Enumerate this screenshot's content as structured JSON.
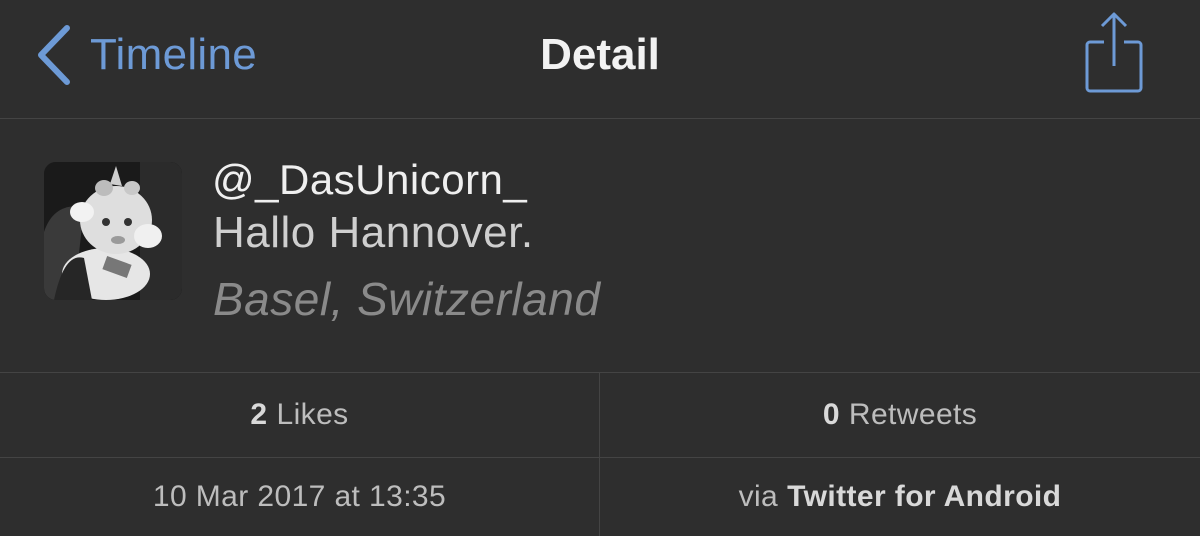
{
  "navbar": {
    "back_label": "Timeline",
    "title": "Detail",
    "accent_color": "#6d9ad6",
    "back_icon": "chevron-left-icon",
    "share_icon": "share-icon"
  },
  "tweet": {
    "handle": "@_DasUnicorn_",
    "text": "Hallo Hannover.",
    "location": "Basel, Switzerland",
    "avatar_icon": "unicorn-plush-avatar"
  },
  "stats": {
    "likes_count": "2",
    "likes_label": "Likes",
    "retweets_count": "0",
    "retweets_label": "Retweets",
    "timestamp": "10 Mar 2017 at 13:35",
    "via_prefix": "via",
    "source": "Twitter for Android"
  }
}
